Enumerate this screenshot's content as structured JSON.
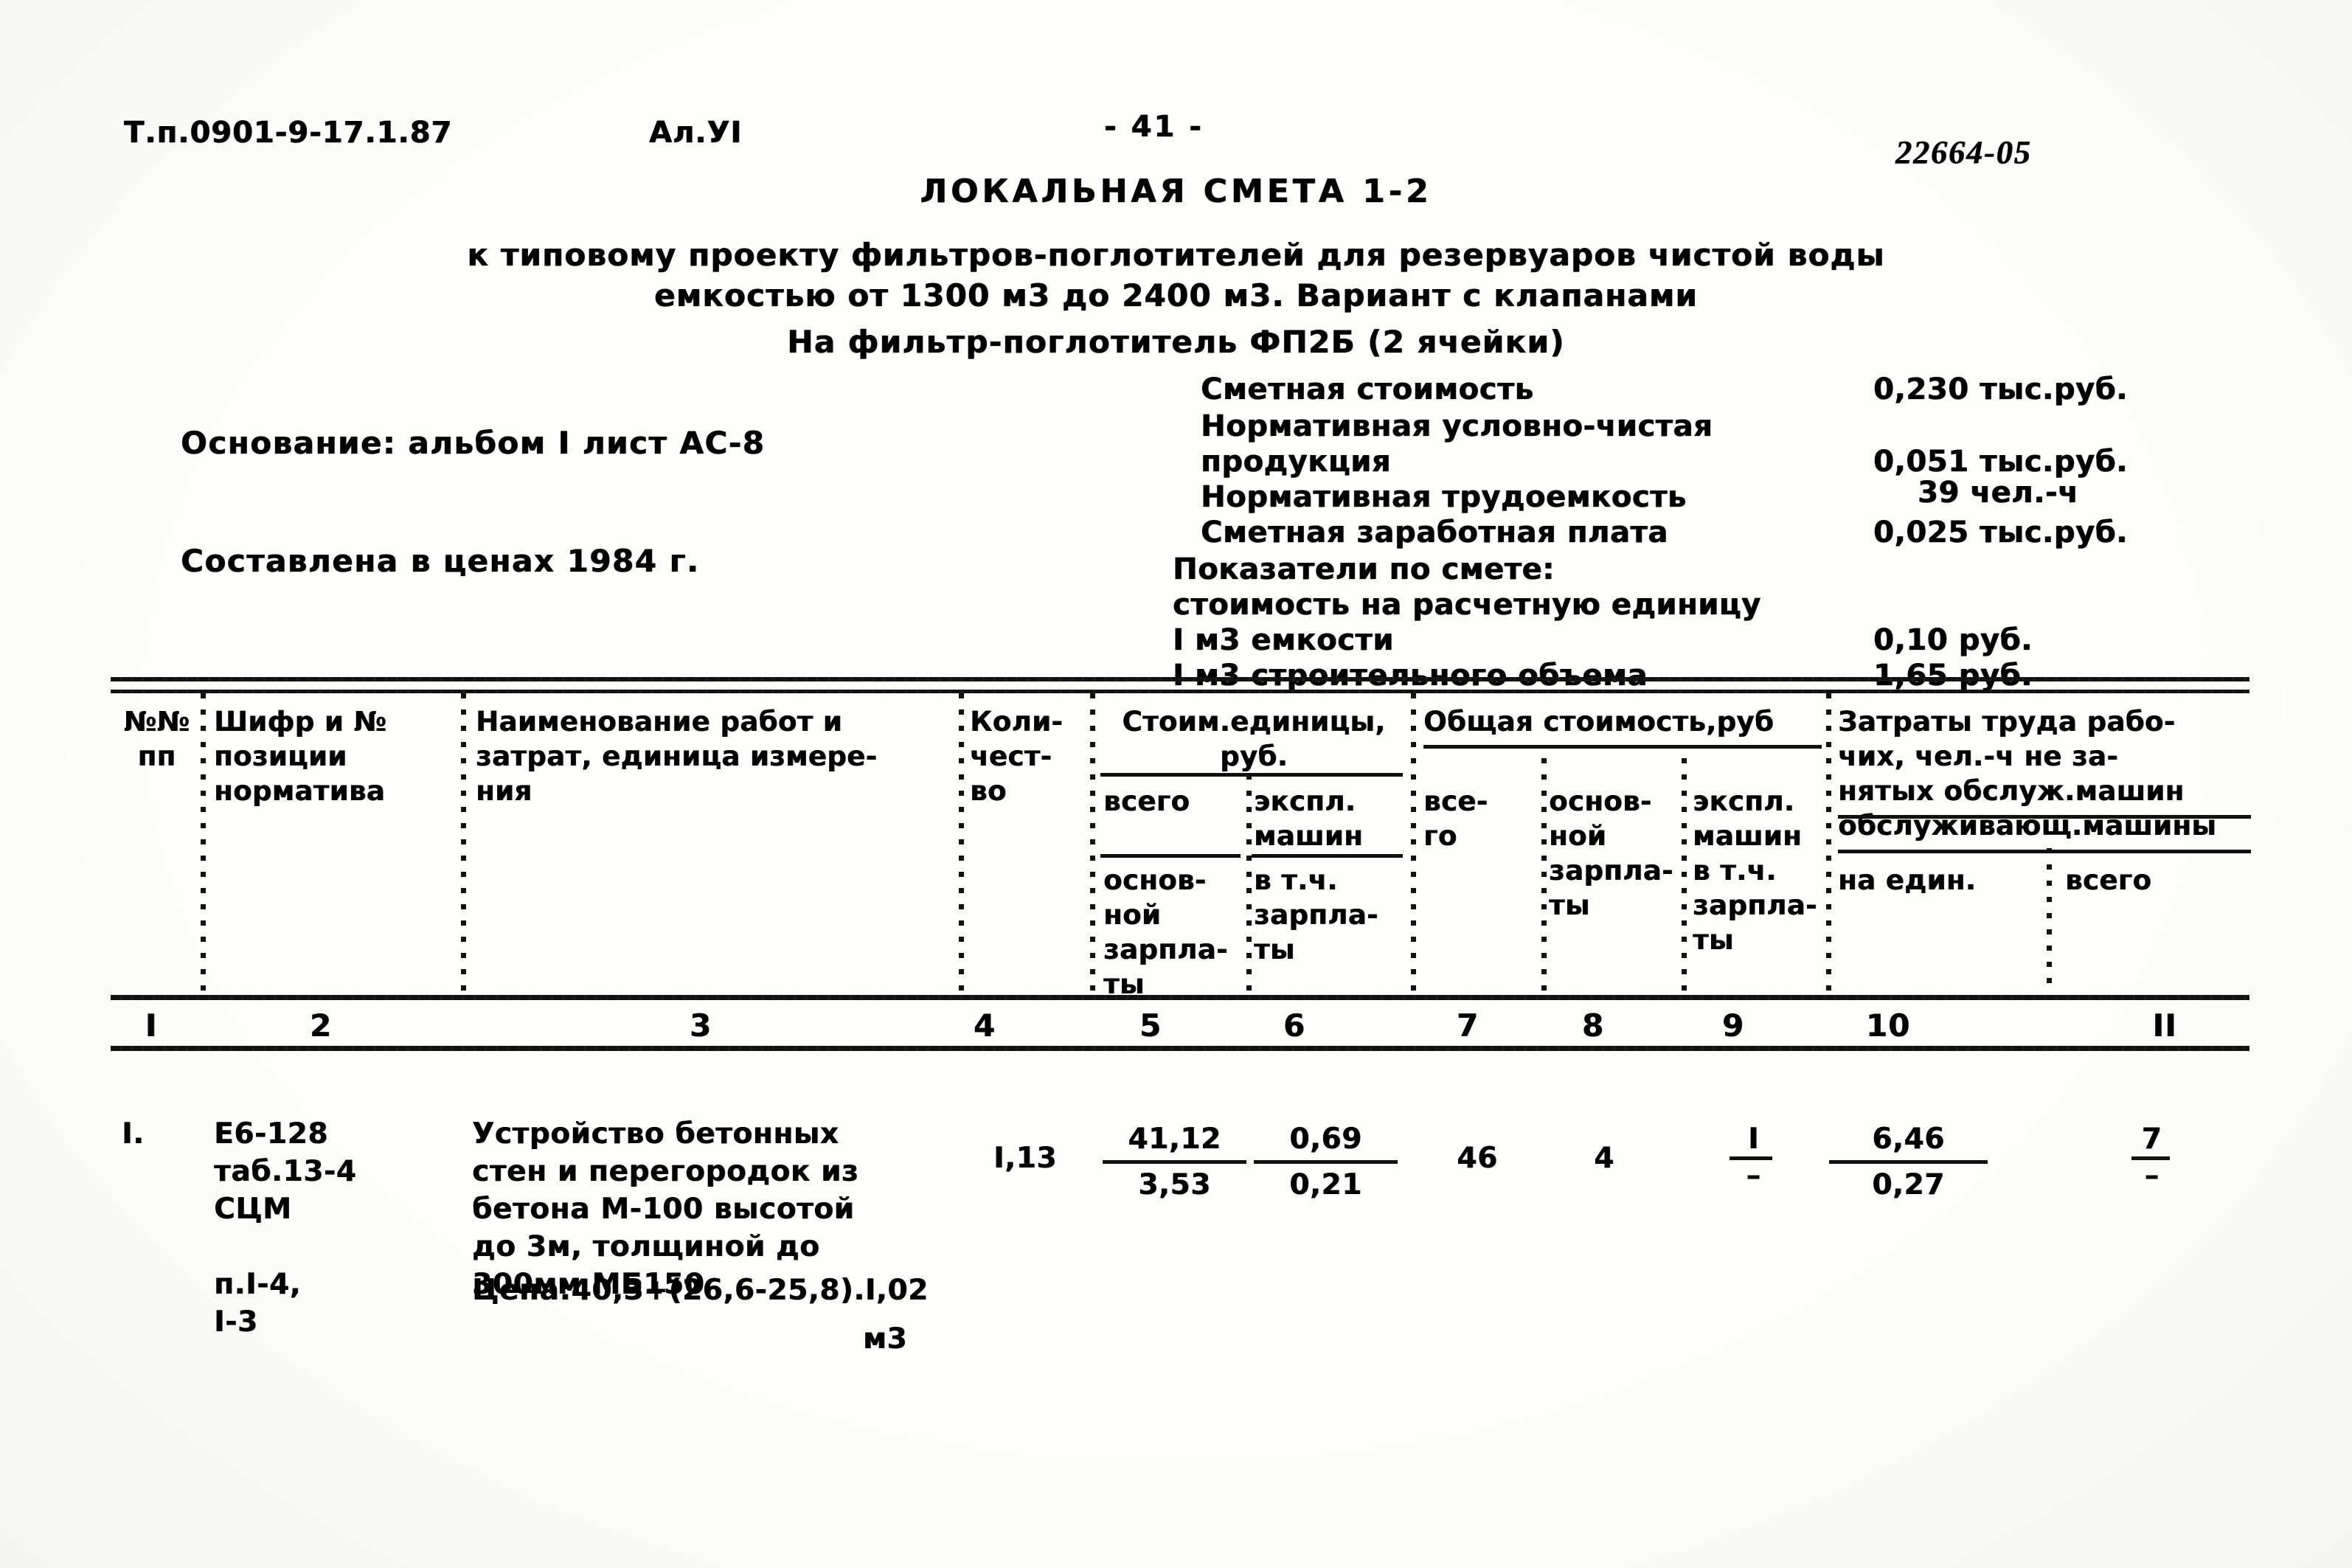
{
  "header": {
    "doc_code": "Т.п.0901-9-17.1.87",
    "album": "Ал.УI",
    "page_number": "- 41 -",
    "archive_number": "22664-05"
  },
  "titles": {
    "main": "ЛОКАЛЬНАЯ СМЕТА 1-2",
    "sub1": "к типовому проекту фильтров-поглотителей для резервуаров чистой воды",
    "sub2": "емкостью от 1300 м3 до 2400 м3. Вариант с клапанами",
    "sub3": "На фильтр-поглотитель ФП2Б (2 ячейки)"
  },
  "info": {
    "basis": "Основание: альбом I лист АС-8",
    "prices": "Составлена в ценах 1984 г."
  },
  "summary": {
    "label_estimate_cost": "Сметная стоимость",
    "value_estimate_cost": "0,230 тыс.руб.",
    "label_net_output_1": "Нормативная условно-чистая",
    "label_net_output_2": "продукция",
    "value_net_output": "0,051 тыс.руб.",
    "label_labor": "Нормативная трудоемкость",
    "value_labor": "39 чел.-ч",
    "label_wages": "Сметная заработная плата",
    "value_wages": "0,025 тыс.руб.",
    "label_indicators": "Показатели по смете:",
    "label_unit_cost": "стоимость на расчетную единицу",
    "label_per_m3_capacity": "I м3 емкости",
    "value_per_m3_capacity": "0,10 руб.",
    "label_per_m3_volume": "I м3 строительного объема",
    "value_per_m3_volume": "1,65 руб."
  },
  "table": {
    "headers": {
      "col1": "№№\nпп",
      "col2": "Шифр и №\nпозиции\nнорматива",
      "col3": "Наименование работ и\nзатрат, единица измере-\nния",
      "col4": "Коли-\nчест-\nво",
      "col5_group": "Стоим.единицы,\nруб.",
      "col5_a": "всего",
      "col5_b": "основ-\nной\nзарпла-\nты",
      "col6_a": "экспл.\nмашин",
      "col6_b": "в т.ч.\nзарпла-\nты",
      "col7_group": "Общая стоимость,руб",
      "col7": "все-\nго",
      "col8": "основ-\nной\nзарпла-\nты",
      "col9": "экспл.\nмашин\nв т.ч.\nзарпла-\nты",
      "col10_group": "Затраты труда рабо-\nчих, чел.-ч не за-\nнятых обслуж.машин\nобслуживающ.машины",
      "col10": "на един.",
      "col11": "всего"
    },
    "column_numbers": [
      "I",
      "2",
      "3",
      "4",
      "5",
      "6",
      "7",
      "8",
      "9",
      "10",
      "II"
    ],
    "rows": [
      {
        "no": "I.",
        "code": "Е6-128\nтаб.13-4\nСЦМ\n\nп.I-4,\nI-3",
        "name_lines": "Устройство бетонных\nстен и перегородок из\nбетона М-100 высотой\nдо 3м, толщиной до\n300мм МБ150",
        "price_note": "Цена:40,3+(26,6-25,8).I,02",
        "unit": "м3",
        "quantity": "I,13",
        "unit_cost_total": "41,12",
        "unit_cost_wage": "3,53",
        "unit_cost_mach": "0,69",
        "unit_cost_mach_wage": "0,21",
        "total_cost_all": "46",
        "total_cost_wage": "4",
        "total_cost_mach": "I",
        "total_cost_mach_wage": "–",
        "labor_per_unit_top": "6,46",
        "labor_per_unit_bottom": "0,27",
        "labor_total_top": "7",
        "labor_total_bottom": "–"
      }
    ]
  }
}
